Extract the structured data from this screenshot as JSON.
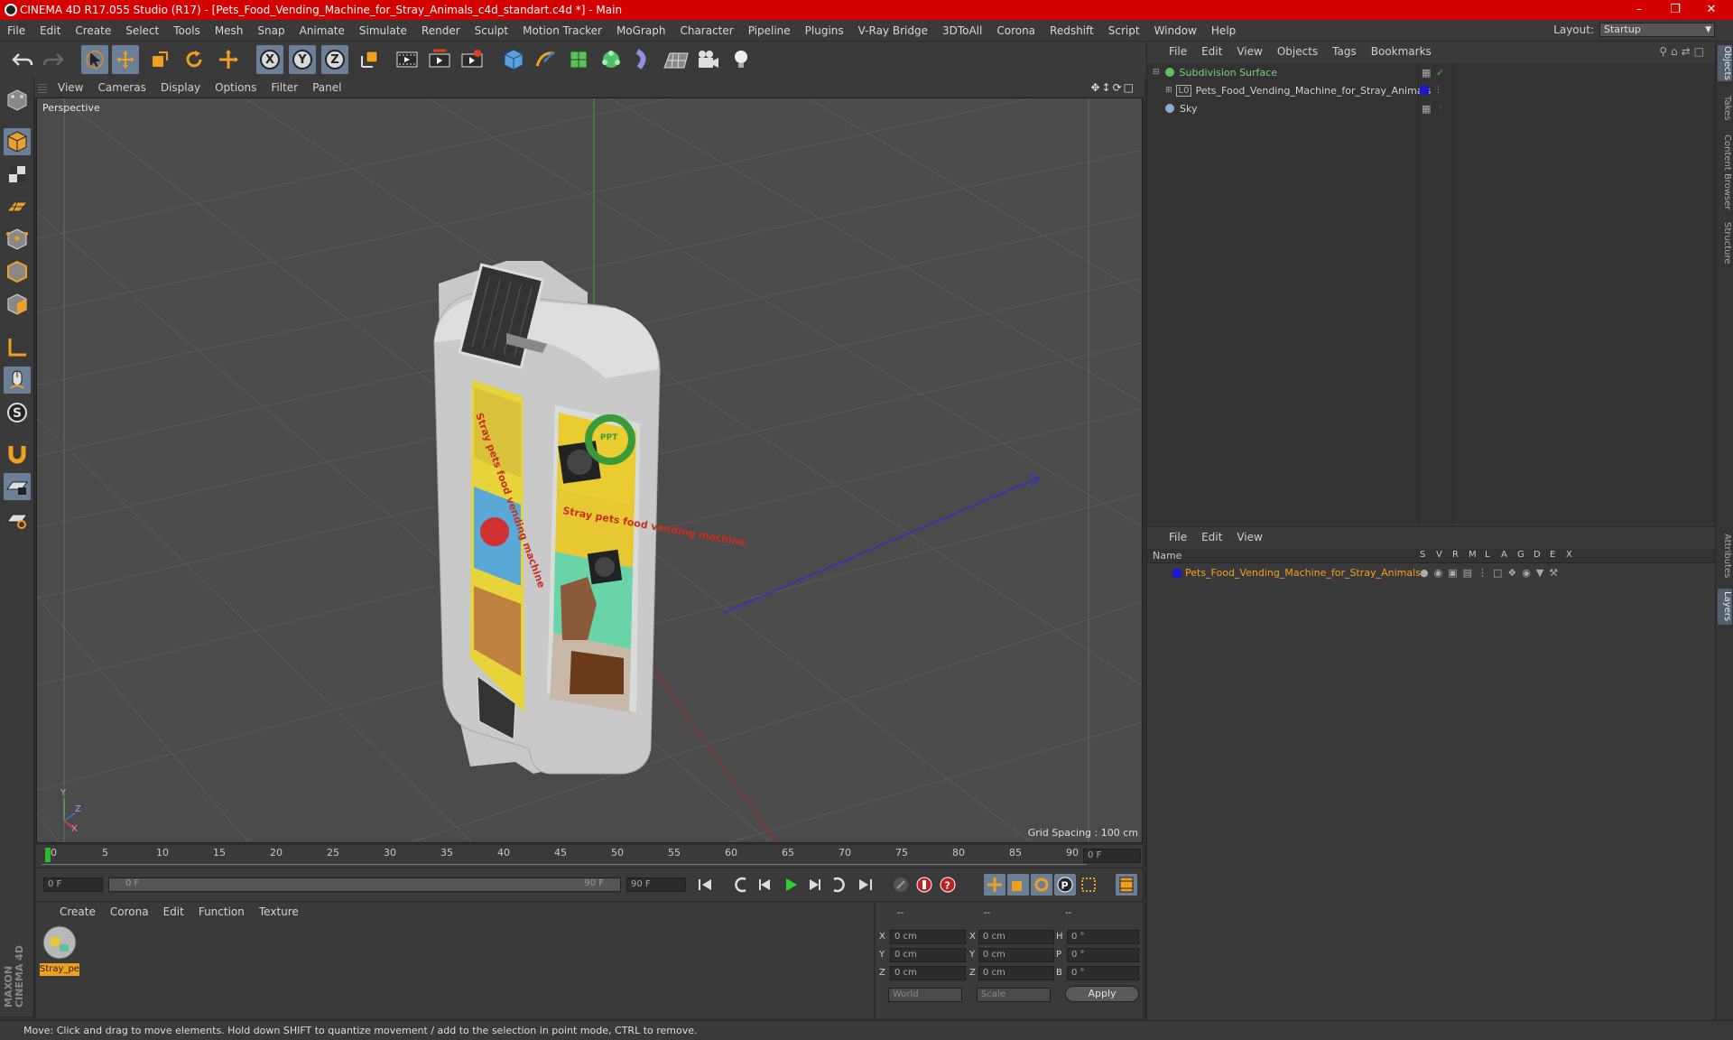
{
  "window": {
    "title": "CINEMA 4D R17.055 Studio (R17) - [Pets_Food_Vending_Machine_for_Stray_Animals_c4d_standart.c4d *] - Main",
    "controls": [
      "–",
      "❐",
      "✕"
    ]
  },
  "menubar": [
    "File",
    "Edit",
    "Create",
    "Select",
    "Tools",
    "Mesh",
    "Snap",
    "Animate",
    "Simulate",
    "Render",
    "Sculpt",
    "Motion Tracker",
    "MoGraph",
    "Character",
    "Pipeline",
    "Plugins",
    "V-Ray Bridge",
    "3DToAll",
    "Corona",
    "Redshift",
    "Script",
    "Window",
    "Help"
  ],
  "layout": {
    "label": "Layout:",
    "value": "Startup"
  },
  "toolbar": {
    "axis_labels": [
      "X",
      "Y",
      "Z"
    ]
  },
  "viewport": {
    "menu": [
      "View",
      "Cameras",
      "Display",
      "Options",
      "Filter",
      "Panel"
    ],
    "label": "Perspective",
    "grid_spacing": "Grid Spacing : 100 cm",
    "axis_y": "Y",
    "axis_z": "Z",
    "axis_x": "X"
  },
  "timeline": {
    "ticks": [
      "0",
      "5",
      "10",
      "15",
      "20",
      "25",
      "30",
      "35",
      "40",
      "45",
      "50",
      "55",
      "60",
      "65",
      "70",
      "75",
      "80",
      "85",
      "90"
    ],
    "current_frame": "0 F",
    "start_field": "0 F",
    "range_start": "0 F",
    "range_end": "90 F",
    "end_field": "90 F"
  },
  "material_manager": {
    "menu": [
      "Create",
      "Corona",
      "Edit",
      "Function",
      "Texture"
    ],
    "material_name": "Stray_pe"
  },
  "coordinates": {
    "headers": [
      "--",
      "--",
      "--"
    ],
    "rows": [
      {
        "l1": "X",
        "v1": "0 cm",
        "l2": "X",
        "v2": "0 cm",
        "l3": "H",
        "v3": "0 °"
      },
      {
        "l1": "Y",
        "v1": "0 cm",
        "l2": "Y",
        "v2": "0 cm",
        "l3": "P",
        "v3": "0 °"
      },
      {
        "l1": "Z",
        "v1": "0 cm",
        "l2": "Z",
        "v2": "0 cm",
        "l3": "B",
        "v3": "0 °"
      }
    ],
    "mode1": "World",
    "mode2": "Scale",
    "apply": "Apply"
  },
  "object_manager": {
    "menu": [
      "File",
      "Edit",
      "View",
      "Objects",
      "Tags",
      "Bookmarks"
    ],
    "objects": [
      {
        "name": "Subdivision Surface",
        "color": "#7ad17a"
      },
      {
        "name": "Pets_Food_Vending_Machine_for_Stray_Animals",
        "color": "#d0d0d0"
      },
      {
        "name": "Sky",
        "color": "#d0d0d0"
      }
    ]
  },
  "layer_manager": {
    "menu": [
      "File",
      "Edit",
      "View"
    ],
    "name_header": "Name",
    "flag_headers": [
      "S",
      "V",
      "R",
      "M",
      "L",
      "A",
      "G",
      "D",
      "E",
      "X"
    ],
    "layer_name": "Pets_Food_Vending_Machine_for_Stray_Animals",
    "layer_color": "#1a1acc"
  },
  "right_tabs": [
    "Objects",
    "Takes",
    "Content Browser",
    "Structure",
    "Attributes",
    "Layers"
  ],
  "status": "Move: Click and drag to move elements. Hold down SHIFT to quantize movement / add to the selection in point mode, CTRL to remove.",
  "machine_text": {
    "side": "Stray pets food vending machine",
    "front": "Stray pets food vending machine",
    "logo": "PPT"
  },
  "maxon_logo": "MAXON CINEMA 4D",
  "colors": {
    "title_bar": "#d40000",
    "accent": "#f0a020",
    "selected": "#6b7f96"
  }
}
